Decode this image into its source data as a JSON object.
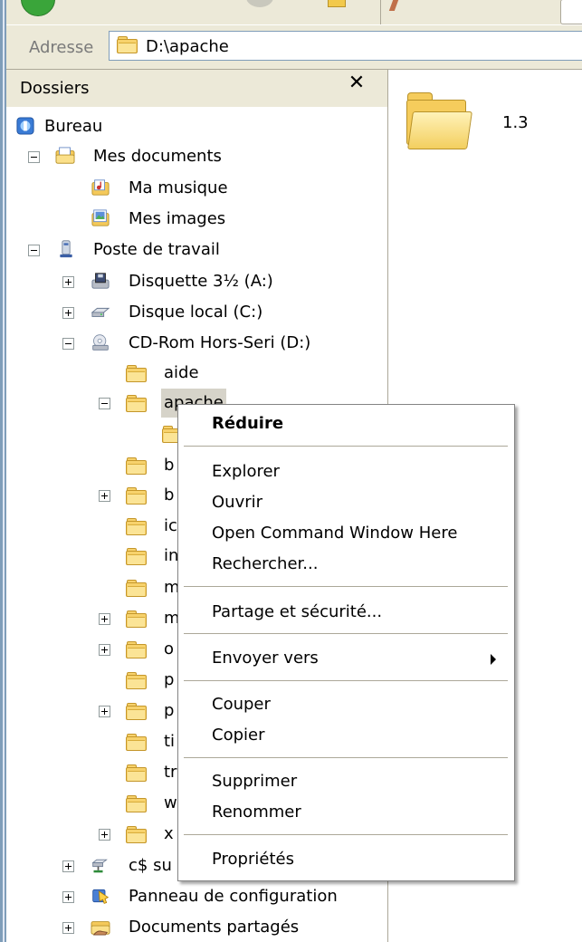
{
  "address": {
    "label": "Adresse",
    "value": "D:\\apache"
  },
  "folders_pane": {
    "title": "Dossiers",
    "close_glyph": "✕",
    "tree": [
      {
        "label": "Bureau"
      },
      {
        "label": "Mes documents"
      },
      {
        "label": "Ma musique"
      },
      {
        "label": "Mes images"
      },
      {
        "label": "Poste de travail"
      },
      {
        "label": "Disquette 3½ (A:)"
      },
      {
        "label": "Disque local (C:)"
      },
      {
        "label": "CD-Rom Hors-Seri (D:)"
      },
      {
        "label": "aide"
      },
      {
        "label": "apache"
      },
      {
        "label": "b"
      },
      {
        "label": "b"
      },
      {
        "label": "ic"
      },
      {
        "label": "in"
      },
      {
        "label": "m"
      },
      {
        "label": "m"
      },
      {
        "label": "o"
      },
      {
        "label": "p"
      },
      {
        "label": "p"
      },
      {
        "label": "ti"
      },
      {
        "label": "tr"
      },
      {
        "label": "w"
      },
      {
        "label": "x"
      },
      {
        "label": "c$ su"
      },
      {
        "label": "Panneau de configuration"
      },
      {
        "label": "Documents partagés"
      }
    ]
  },
  "content": {
    "items": [
      {
        "label": "1.3"
      }
    ]
  },
  "context_menu": {
    "items": [
      "Réduire",
      "Explorer",
      "Ouvrir",
      "Open Command Window Here",
      "Rechercher...",
      "Partage et sécurité...",
      "Envoyer vers",
      "Couper",
      "Copier",
      "Supprimer",
      "Renommer",
      "Propriétés"
    ]
  }
}
